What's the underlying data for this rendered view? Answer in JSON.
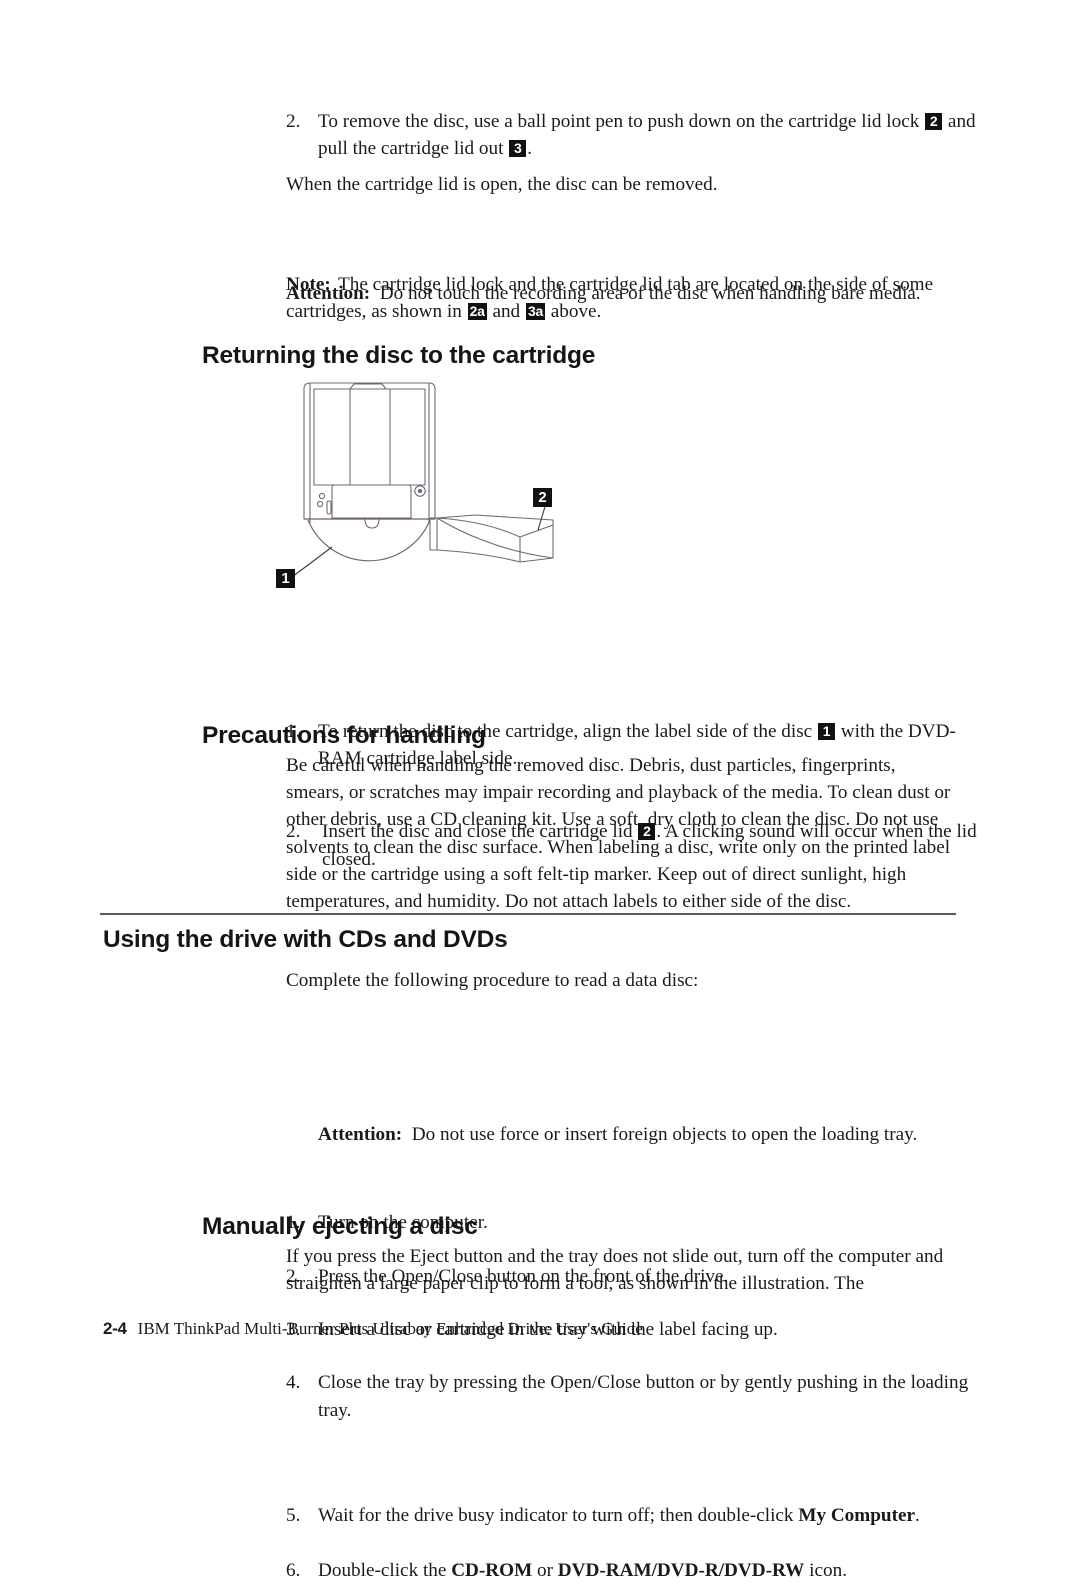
{
  "document": {
    "page_number": "2-4",
    "footer_text": "IBM ThinkPad Multi-Burner Plus Ultrabay Enhanced Drive: User's Guide"
  },
  "top_section": {
    "step2": {
      "marker": "2.",
      "text_part1": "To remove the disc, use a ball point pen to push down on the cartridge lid lock",
      "badge_a": "2",
      "text_part2": "and pull the cartridge lid out",
      "badge_b": "3",
      "text_part3": "."
    },
    "paragraph_open_lid": "When the cartridge lid is open, the disc can be removed.",
    "note": {
      "label": "Note:",
      "text_part1": "The cartridge lid lock and the cartridge lid tab are located on the side of some cartridges, as shown in",
      "badge_a": "2a",
      "text_part2": "and",
      "badge_b": "3a",
      "text_part3": "above."
    },
    "attention": {
      "label": "Attention:",
      "text": "Do not touch the recording area of the disc when handling bare media."
    }
  },
  "returning_section": {
    "heading": "Returning the disc to the cartridge",
    "figure": {
      "callout_1": "1",
      "callout_2": "2",
      "alt": "DVD-RAM cartridge with the disc partially removed and the cartridge lid swung open"
    },
    "steps": [
      {
        "marker": "1.",
        "text_part1": "To return the disc to the cartridge, align the label side of the disc",
        "badge": "1",
        "text_part2": "with the DVD-RAM cartridge label side."
      },
      {
        "marker": "2.",
        "text_part1": "Insert the disc and close the cartridge lid",
        "badge": "2",
        "text_part2": ". A clicking sound will occur when the lid closed."
      }
    ]
  },
  "precautions_section": {
    "heading": "Precautions for handling",
    "paragraph": "Be careful when handling the removed disc. Debris, dust particles, fingerprints, smears, or scratches may impair recording and playback of the media. To clean dust or other debris, use a CD cleaning kit. Use a soft, dry cloth to clean the disc. Do not use solvents to clean the disc surface. When labeling a disc, write only on the printed label side or the cartridge using a soft felt-tip marker. Keep out of direct sunlight, high temperatures, and humidity. Do not attach labels to either side of the disc."
  },
  "using_drive_section": {
    "heading": "Using the drive with CDs and DVDs",
    "intro": "Complete the following procedure to read a data disc:",
    "steps": [
      {
        "marker": "1.",
        "text": "Turn on the computer."
      },
      {
        "marker": "2.",
        "text": "Press the Open/Close button on the front of the drive."
      },
      {
        "marker": "3.",
        "text": "Insert a disc or cartridge in the tray with the label facing up."
      },
      {
        "marker": "4.",
        "text": "Close the tray by pressing the Open/Close button or by gently pushing in the loading tray."
      }
    ],
    "attention": {
      "label": "Attention:",
      "text": "Do not use force or insert foreign objects to open the loading tray."
    },
    "step5": {
      "marker": "5.",
      "text_part1": "Wait for the drive busy indicator to turn off; then double-click",
      "bold": "My Computer",
      "text_part2": "."
    },
    "step6": {
      "marker": "6.",
      "text_part1": "Double-click the",
      "bold_a": "CD-ROM",
      "text_part2": "or",
      "bold_b": "DVD-RAM/DVD-R/DVD-RW",
      "text_part3": "icon."
    }
  },
  "ejecting_section": {
    "heading": "Manually ejecting a disc",
    "paragraph": "If you press the Eject button and the tray does not slide out, turn off the computer and straighten a large paper clip to form a tool, as shown in the illustration. The"
  }
}
